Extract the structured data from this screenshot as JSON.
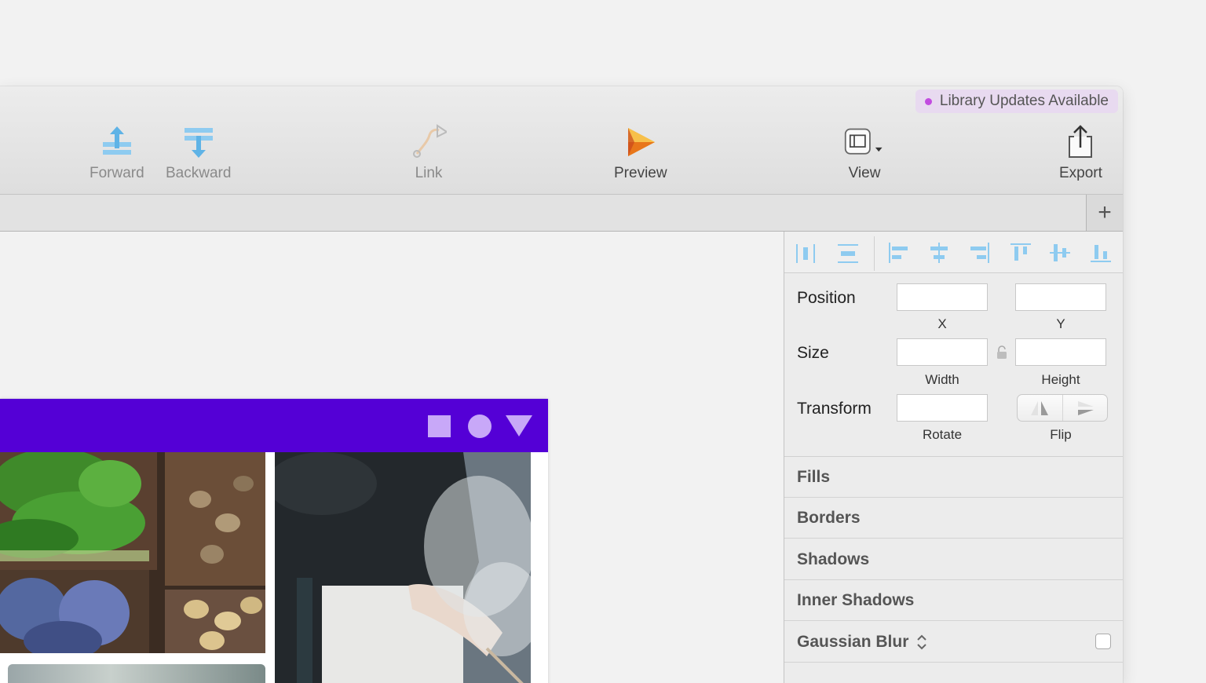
{
  "toolbar": {
    "library_badge": "Library Updates Available",
    "buttons": [
      {
        "label": "Forward",
        "icon": "forward-icon"
      },
      {
        "label": "Backward",
        "icon": "backward-icon"
      },
      {
        "label": "Link",
        "icon": "link-icon"
      },
      {
        "label": "Preview",
        "icon": "preview-play-icon"
      },
      {
        "label": "View",
        "icon": "view-layout-icon"
      },
      {
        "label": "Export",
        "icon": "export-share-icon"
      }
    ]
  },
  "tabbar": {
    "add_label": "+"
  },
  "canvas": {
    "artboard_header_color": "#5400d6",
    "header_icons": [
      "square-icon",
      "circle-icon",
      "triangle-icon"
    ]
  },
  "inspector": {
    "align_icons": [
      "distribute-horizontal-icon",
      "distribute-vertical-icon",
      "align-left-icon",
      "align-center-horizontal-icon",
      "align-right-icon",
      "align-top-icon",
      "align-middle-vertical-icon",
      "align-bottom-icon"
    ],
    "position": {
      "label": "Position",
      "x_label": "X",
      "y_label": "Y",
      "x_value": "",
      "y_value": ""
    },
    "size": {
      "label": "Size",
      "width_label": "Width",
      "height_label": "Height",
      "width_value": "",
      "height_value": ""
    },
    "transform": {
      "label": "Transform",
      "rotate_label": "Rotate",
      "flip_label": "Flip",
      "rotate_value": ""
    },
    "sections": [
      "Fills",
      "Borders",
      "Shadows",
      "Inner Shadows",
      "Gaussian Blur"
    ],
    "accent_color": "#8ecbf0"
  }
}
